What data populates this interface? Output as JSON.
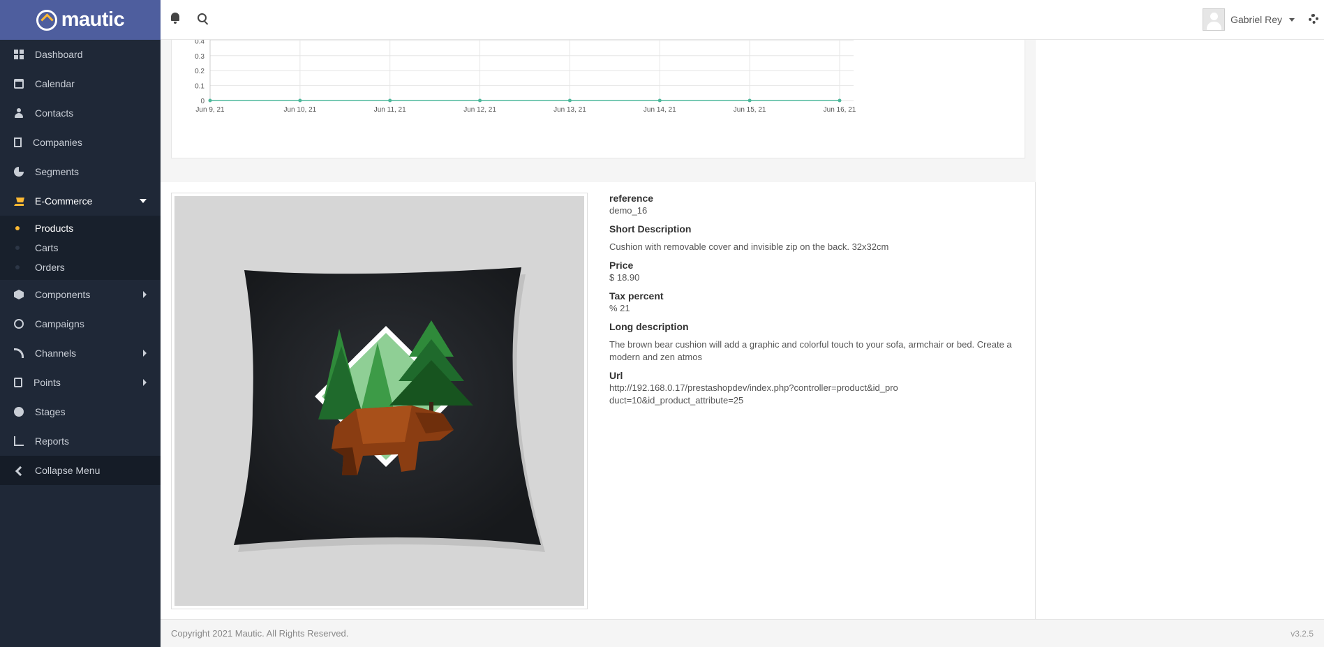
{
  "brand": {
    "name": "mautic"
  },
  "sidebar": {
    "items": [
      {
        "label": "Dashboard",
        "icon": "dashboard-icon"
      },
      {
        "label": "Calendar",
        "icon": "calendar-icon"
      },
      {
        "label": "Contacts",
        "icon": "user-icon"
      },
      {
        "label": "Companies",
        "icon": "building-icon"
      },
      {
        "label": "Segments",
        "icon": "pie-chart-icon"
      },
      {
        "label": "E-Commerce",
        "icon": "cart-icon",
        "expanded": true,
        "children": [
          {
            "label": "Products",
            "active": true
          },
          {
            "label": "Carts"
          },
          {
            "label": "Orders"
          }
        ]
      },
      {
        "label": "Components",
        "icon": "cube-icon",
        "has_submenu": true
      },
      {
        "label": "Campaigns",
        "icon": "clock-icon"
      },
      {
        "label": "Channels",
        "icon": "rss-icon",
        "has_submenu": true
      },
      {
        "label": "Points",
        "icon": "calculator-icon",
        "has_submenu": true
      },
      {
        "label": "Stages",
        "icon": "gauge-icon"
      },
      {
        "label": "Reports",
        "icon": "line-chart-icon"
      }
    ],
    "collapse_label": "Collapse Menu"
  },
  "header": {
    "user_name": "Gabriel Rey"
  },
  "chart_data": {
    "type": "line",
    "x": [
      "Jun 9, 21",
      "Jun 10, 21",
      "Jun 11, 21",
      "Jun 12, 21",
      "Jun 13, 21",
      "Jun 14, 21",
      "Jun 15, 21",
      "Jun 16, 21"
    ],
    "series": [
      {
        "values": [
          0,
          0,
          0,
          0,
          0,
          0,
          0,
          0
        ],
        "color": "#4fb89b"
      }
    ],
    "y_ticks": [
      "0",
      "0.1",
      "0.2",
      "0.3",
      "0.4"
    ],
    "ylim": [
      0,
      0.5
    ],
    "grid": true
  },
  "product": {
    "fields": [
      {
        "label": "reference",
        "value": "demo_16"
      },
      {
        "label": "Short Description",
        "value": "Cushion with removable cover and invisible zip on the back. 32x32cm",
        "spaced": true
      },
      {
        "label": "Price",
        "value": "$ 18.90"
      },
      {
        "label": "Tax percent",
        "value": "% 21"
      },
      {
        "label": "Long description",
        "value": "The brown bear cushion will add a graphic and colorful touch to your sofa, armchair or bed. Create a modern and zen atmos",
        "spaced": true
      },
      {
        "label": "Url",
        "value": "http://192.168.0.17/prestashopdev/index.php?controller=product&id_product=10&id_product_attribute=25"
      }
    ]
  },
  "footer": {
    "copyright": "Copyright 2021 Mautic. All Rights Reserved.",
    "version": "v3.2.5"
  },
  "colors": {
    "sidebar_bg": "#1f2837",
    "brand_bg": "#4e5e9e",
    "accent": "#fdb933",
    "chart_line": "#4fb89b"
  }
}
